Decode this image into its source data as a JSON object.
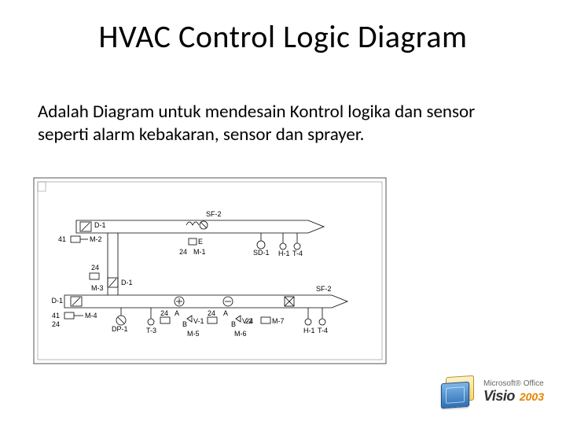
{
  "title": "HVAC Control Logic Diagram",
  "body": "Adalah Diagram untuk mendesain Kontrol logika dan sensor seperti alarm kebakaran, sensor dan sprayer.",
  "diagram": {
    "duct1_tag": "SF-2",
    "duct2_tag": "SF-2",
    "upper": {
      "damper1": "D-1",
      "motor_41": "41",
      "motor_M2": "M-2",
      "heater_E": "E",
      "heat_24": "24",
      "heat_M1": "M-1",
      "sd1": "SD-1",
      "h1": "H-1",
      "t4": "T-4"
    },
    "mid": {
      "n24": "24",
      "m3": "M-3",
      "d1b": "D-1"
    },
    "lower": {
      "damper": "D-1",
      "motor_41": "41",
      "motor_24": "24",
      "m4": "M-4",
      "dp1": "DP-1",
      "t3": "T-3",
      "blk24a": "24",
      "blk24b": "24",
      "a1": "A",
      "a2": "A",
      "b1": "B",
      "b2": "B",
      "v1": "V-1",
      "v2": "V-2",
      "m5": "M-5",
      "m6": "M-6",
      "m7_24": "24",
      "m7": "M-7",
      "h1": "H-1",
      "t4": "T-4"
    }
  },
  "logo": {
    "vendor_line": "Microsoft® Office",
    "product": "Visio",
    "year": "2003"
  }
}
